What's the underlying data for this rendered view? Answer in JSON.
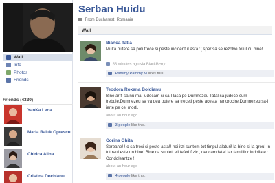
{
  "profile": {
    "name": "Serban Huidu",
    "from": "From Bucharest, Romania"
  },
  "nav": {
    "items": [
      {
        "label": "Wall",
        "icon": "wall-icon",
        "active": true
      },
      {
        "label": "Info",
        "icon": "info-icon",
        "active": false
      },
      {
        "label": "Photos",
        "icon": "photos-icon",
        "active": false
      },
      {
        "label": "Friends",
        "icon": "friends-icon",
        "active": false
      }
    ]
  },
  "friends": {
    "header": "Friends (4320)",
    "list": [
      {
        "name": "YanKa Lena"
      },
      {
        "name": "Maria Raluk Oprescu"
      },
      {
        "name": "Chirica Alina"
      },
      {
        "name": "Cristina Dochianu"
      }
    ]
  },
  "wall": {
    "tab_label": "Wall",
    "posts": [
      {
        "author": "Bianca Tatia",
        "text": "Multa putere sa poti trece si peste incidentul asta :( sper sa se rezolve totul cu bine!",
        "meta": "55 minutes ago via BlackBerry",
        "meta_link": "",
        "likes_user": "Pammy Pammy M",
        "likes_suffix": " likes this."
      },
      {
        "author": "Teodora Roxana Boldianu",
        "text": "Bine ar fi sa nu mai judecam si sa-l lasa pe Dumnezeu Tatal sa judece cum trebuie.Dumnezeu sa va dea putere sa treceti peste acesta nenorocire.Dumnezeu sa-i ierte pe cei morti.",
        "meta": "about an hour ago",
        "meta_link": "",
        "likes_user": "3 people",
        "likes_suffix": " like this."
      },
      {
        "author": "Corina Ghita",
        "text": "Serbane! ! o sa treci si peste asta!! noi itzi suntem tot timpul alaturi! la bine si la greu! In tot raul este un bine! Bine ca sunteti vii teferi fizic , deocamdata! Iar familiilor indoliate : Condoleantze !!",
        "meta": "about an hour ago",
        "meta_link": "",
        "likes_user": "4 people",
        "likes_suffix": " like this."
      }
    ]
  },
  "colors": {
    "brand": "#3b5998",
    "nav_active_bg": "#d8dfea",
    "likes_bg": "#edeff4"
  }
}
